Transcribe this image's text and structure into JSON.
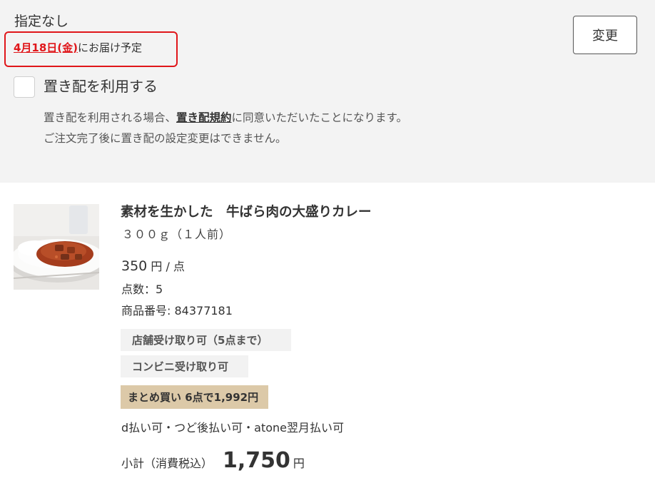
{
  "delivery": {
    "no_spec": "指定なし",
    "date_link": "4月18日(金)",
    "date_suffix": "にお届け予定",
    "change_label": "変更",
    "okihai_label": "置き配を利用する",
    "note_prefix": "置き配を利用される場合、",
    "terms_link": "置き配規約",
    "note_suffix": "に同意いただいたことになります。",
    "note_line2": "ご注文完了後に置き配の設定変更はできません。"
  },
  "product": {
    "title": "素材を生かした　牛ばら肉の大盛りカレー",
    "size": "３００ｇ（１人前）",
    "price": "350",
    "price_unit": " 円 / 点",
    "quantity": "点数：5",
    "code": "商品番号: 84377181",
    "tags": [
      "店舗受け取り可（5点まで）",
      "コンビニ受け取り可"
    ],
    "bulk_offer": "まとめ買い 6点で1,992円",
    "payment": "d払い可・つど後払い可・atone翌月払い可",
    "subtotal_label": "小計（消費税込）",
    "subtotal_amount": "1,750",
    "subtotal_unit": "円"
  },
  "colors": {
    "accent_red": "#e0161a",
    "panel_bg": "#f3f3f3",
    "bulk_tag_bg": "#dcc9a8"
  }
}
